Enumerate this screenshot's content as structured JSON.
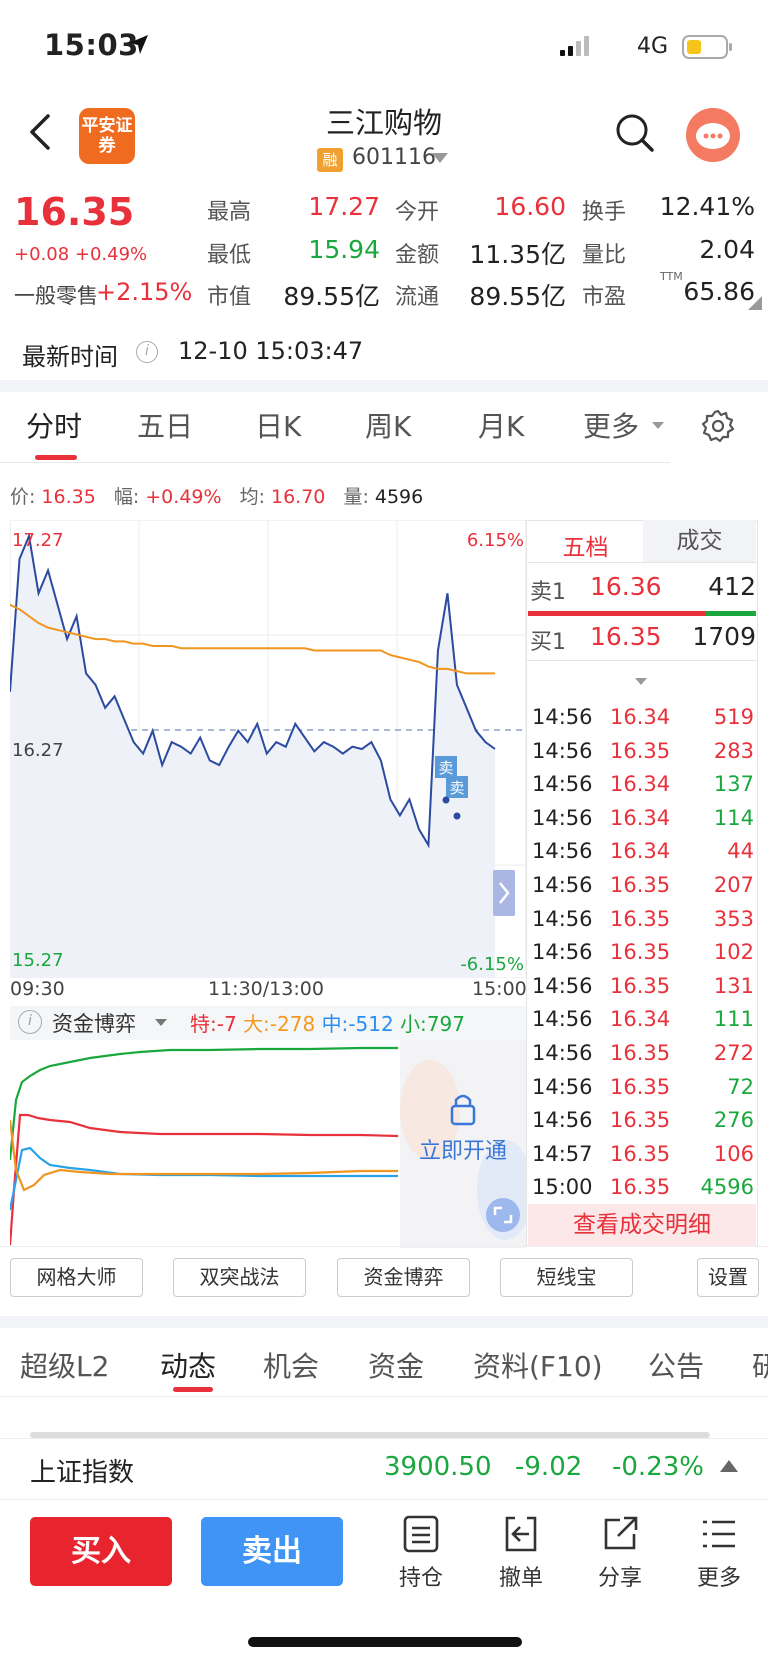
{
  "status_bar": {
    "time": "15:03",
    "network": "4G"
  },
  "nav": {
    "logo_text": "平安证券",
    "stock_name": "三江购物",
    "rong_badge": "融",
    "stock_code": "601116"
  },
  "quote": {
    "price": "16.35",
    "change": "+0.08 +0.49%",
    "sector_name": "一般零售",
    "sector_pct": "+2.15%",
    "fields": [
      {
        "label": "最高",
        "value": "17.27",
        "color": "red"
      },
      {
        "label": "今开",
        "value": "16.60",
        "color": "red"
      },
      {
        "label": "换手",
        "value": "12.41%",
        "color": "black"
      },
      {
        "label": "最低",
        "value": "15.94",
        "color": "green"
      },
      {
        "label": "金额",
        "value": "11.35亿",
        "color": "black"
      },
      {
        "label": "量比",
        "value": "2.04",
        "color": "black"
      },
      {
        "label": "市值",
        "value": "89.55亿",
        "color": "black"
      },
      {
        "label": "流通",
        "value": "89.55亿",
        "color": "black"
      },
      {
        "label": "市盈",
        "value": "65.86",
        "color": "black"
      }
    ],
    "pe_superscript": "TTM",
    "latest_time_label": "最新时间",
    "latest_time": "12-10 15:03:47"
  },
  "chart_tabs": [
    "分时",
    "五日",
    "日K",
    "周K",
    "月K",
    "更多"
  ],
  "info_line": {
    "price_label": "价:",
    "price": "16.35",
    "amp_label": "幅:",
    "amp": "+0.49%",
    "avg_label": "均:",
    "avg": "16.70",
    "vol_label": "量:",
    "vol": "4596"
  },
  "intraday": {
    "y_top": "17.27",
    "y_mid": "16.27",
    "y_bot": "15.27",
    "pct_top": "6.15%",
    "pct_bot": "-6.15%",
    "x_start": "09:30",
    "x_mid": "11:30/13:00",
    "x_end": "15:00",
    "sell_marker": "卖"
  },
  "chart_data": {
    "type": "line",
    "title": "",
    "ylim": [
      15.27,
      17.27
    ],
    "x": [
      "09:30",
      "11:30/13:00",
      "15:00"
    ],
    "series": [
      {
        "name": "",
        "color": "#2b4aa0",
        "values": [
          16.52,
          17.1,
          17.2,
          16.95,
          17.05,
          16.9,
          16.75,
          16.85,
          16.6,
          16.55,
          16.45,
          16.5,
          16.4,
          16.3,
          16.25,
          16.35,
          16.2,
          16.3,
          16.28,
          16.25,
          16.32,
          16.22,
          16.2,
          16.28,
          16.35,
          16.3,
          16.38,
          16.25,
          16.3,
          16.28,
          16.38,
          16.32,
          16.26,
          16.3,
          16.28,
          16.25,
          16.28,
          16.27,
          16.3,
          16.22,
          16.05,
          15.98,
          16.05,
          15.92,
          15.85,
          16.7,
          16.95,
          16.55,
          16.45,
          16.35,
          16.3,
          16.27
        ]
      },
      {
        "name": "",
        "color": "#f0951f",
        "values": [
          16.9,
          16.88,
          16.85,
          16.82,
          16.8,
          16.79,
          16.78,
          16.77,
          16.76,
          16.75,
          16.75,
          16.74,
          16.74,
          16.73,
          16.73,
          16.72,
          16.72,
          16.72,
          16.71,
          16.71,
          16.71,
          16.71,
          16.71,
          16.71,
          16.71,
          16.71,
          16.71,
          16.71,
          16.71,
          16.71,
          16.71,
          16.71,
          16.7,
          16.7,
          16.7,
          16.7,
          16.7,
          16.7,
          16.7,
          16.7,
          16.68,
          16.67,
          16.66,
          16.65,
          16.63,
          16.62,
          16.62,
          16.61,
          16.6,
          16.6,
          16.6,
          16.6
        ]
      }
    ]
  },
  "fund_flow": {
    "title": "资金博弈",
    "te_label": "特:",
    "te": "-7",
    "da_label": "大:",
    "da": "-278",
    "zhong_label": "中:",
    "zhong": "-512",
    "xiao_label": "小:",
    "xiao": "797",
    "unlock_text": "立即开通"
  },
  "order_book": {
    "tab_active": "五档",
    "tab_other": "成交",
    "ask": {
      "label": "卖1",
      "price": "16.36",
      "vol": "412"
    },
    "bid": {
      "label": "买1",
      "price": "16.35",
      "vol": "1709"
    },
    "trades": [
      {
        "time": "14:56",
        "price": "16.34",
        "vol": "519",
        "vcolor": "red"
      },
      {
        "time": "14:56",
        "price": "16.35",
        "vol": "283",
        "vcolor": "red"
      },
      {
        "time": "14:56",
        "price": "16.34",
        "vol": "137",
        "vcolor": "green"
      },
      {
        "time": "14:56",
        "price": "16.34",
        "vol": "114",
        "vcolor": "green"
      },
      {
        "time": "14:56",
        "price": "16.34",
        "vol": "44",
        "vcolor": "red"
      },
      {
        "time": "14:56",
        "price": "16.35",
        "vol": "207",
        "vcolor": "red"
      },
      {
        "time": "14:56",
        "price": "16.35",
        "vol": "353",
        "vcolor": "red"
      },
      {
        "time": "14:56",
        "price": "16.35",
        "vol": "102",
        "vcolor": "red"
      },
      {
        "time": "14:56",
        "price": "16.35",
        "vol": "131",
        "vcolor": "red"
      },
      {
        "time": "14:56",
        "price": "16.34",
        "vol": "111",
        "vcolor": "green"
      },
      {
        "time": "14:56",
        "price": "16.35",
        "vol": "272",
        "vcolor": "red"
      },
      {
        "time": "14:56",
        "price": "16.35",
        "vol": "72",
        "vcolor": "green"
      },
      {
        "time": "14:56",
        "price": "16.35",
        "vol": "276",
        "vcolor": "green"
      },
      {
        "time": "14:57",
        "price": "16.35",
        "vol": "106",
        "vcolor": "red"
      },
      {
        "time": "15:00",
        "price": "16.35",
        "vol": "4596",
        "vcolor": "green"
      }
    ],
    "detail_label": "查看成交明细"
  },
  "tools": [
    "网格大师",
    "双突战法",
    "资金博弈",
    "短线宝",
    "设置"
  ],
  "bottom_tabs": [
    "超级L2",
    "动态",
    "机会",
    "资金",
    "资料(F10)",
    "公告",
    "研"
  ],
  "index_bar": {
    "name": "上证指数",
    "value": "3900.50",
    "change": "-9.02",
    "pct": "-0.23%"
  },
  "trade_bar": {
    "buy": "买入",
    "sell": "卖出",
    "actions": [
      "持仓",
      "撤单",
      "分享",
      "更多"
    ]
  },
  "colors": {
    "up": "#e8313a",
    "down": "#1aa83e",
    "accent_blue": "#3f94f5"
  }
}
